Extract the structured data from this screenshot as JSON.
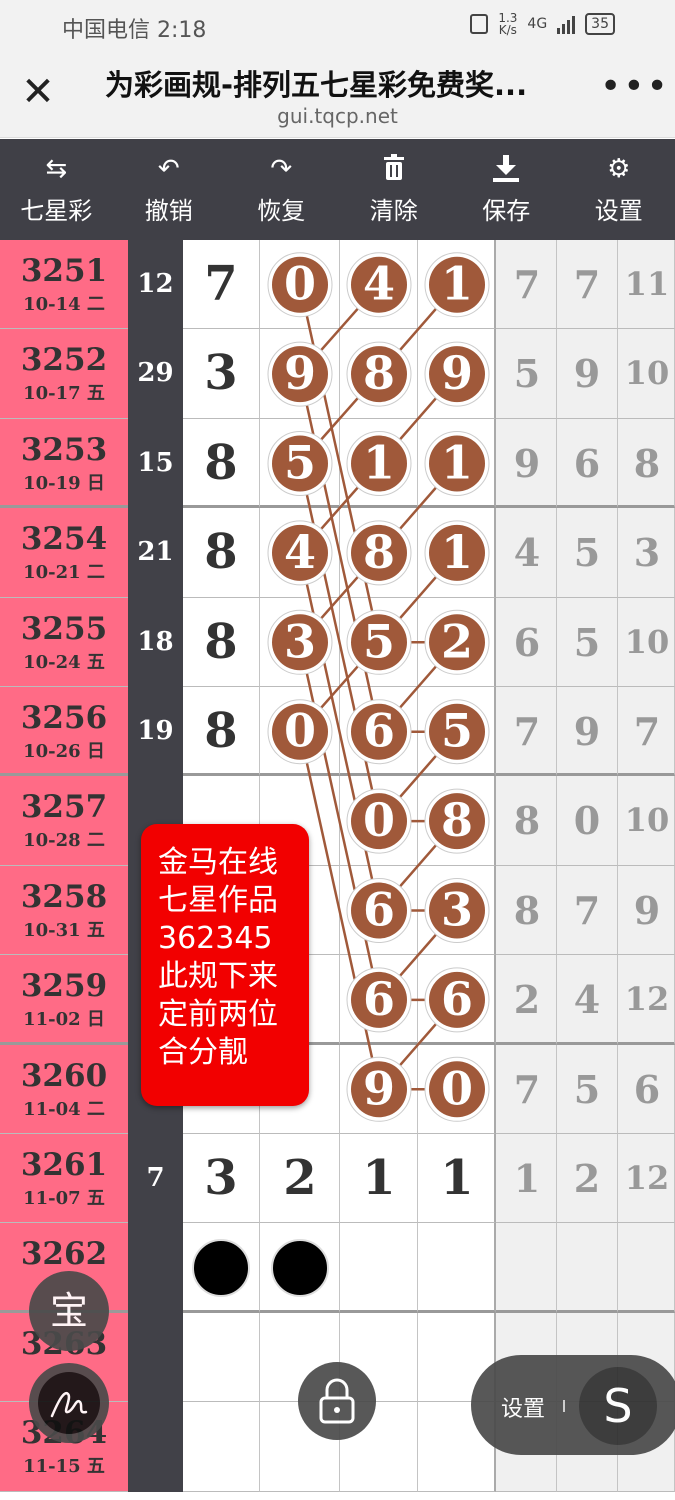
{
  "status_bar": {
    "carrier_time": "中国电信 2:18",
    "net_speed_value": "1.3",
    "net_speed_unit": "K/s",
    "network": "4G",
    "battery": "35"
  },
  "title_bar": {
    "title": "为彩画规-排列五七星彩免费奖...",
    "url": "gui.tqcp.net",
    "close_icon": "close-icon",
    "more_icon": "more-icon"
  },
  "toolbar": [
    {
      "label": "七星彩",
      "icon": "swap-icon"
    },
    {
      "label": "撤销",
      "icon": "undo-icon"
    },
    {
      "label": "恢复",
      "icon": "redo-icon"
    },
    {
      "label": "清除",
      "icon": "trash-icon"
    },
    {
      "label": "保存",
      "icon": "download-icon"
    },
    {
      "label": "设置",
      "icon": "gear-icon"
    }
  ],
  "rows": [
    {
      "issue": "3251",
      "date": "10-14 二",
      "sum": "12",
      "digits": [
        "7",
        "0",
        "4",
        "1"
      ],
      "circled": [
        false,
        true,
        true,
        true
      ],
      "tail": [
        "7",
        "7",
        "11"
      ]
    },
    {
      "issue": "3252",
      "date": "10-17 五",
      "sum": "29",
      "digits": [
        "3",
        "9",
        "8",
        "9"
      ],
      "circled": [
        false,
        true,
        true,
        true
      ],
      "tail": [
        "5",
        "9",
        "10"
      ]
    },
    {
      "issue": "3253",
      "date": "10-19 日",
      "sum": "15",
      "digits": [
        "8",
        "5",
        "1",
        "1"
      ],
      "circled": [
        false,
        true,
        true,
        true
      ],
      "tail": [
        "9",
        "6",
        "8"
      ]
    },
    {
      "issue": "3254",
      "date": "10-21 二",
      "sum": "21",
      "digits": [
        "8",
        "4",
        "8",
        "1"
      ],
      "circled": [
        false,
        true,
        true,
        true
      ],
      "tail": [
        "4",
        "5",
        "3"
      ]
    },
    {
      "issue": "3255",
      "date": "10-24 五",
      "sum": "18",
      "digits": [
        "8",
        "3",
        "5",
        "2"
      ],
      "circled": [
        false,
        true,
        true,
        true
      ],
      "tail": [
        "6",
        "5",
        "10"
      ]
    },
    {
      "issue": "3256",
      "date": "10-26 日",
      "sum": "19",
      "digits": [
        "8",
        "0",
        "6",
        "5"
      ],
      "circled": [
        false,
        true,
        true,
        true
      ],
      "tail": [
        "7",
        "9",
        "7"
      ]
    },
    {
      "issue": "3257",
      "date": "10-28 二",
      "sum": "",
      "digits": [
        "",
        "",
        "0",
        "8"
      ],
      "circled": [
        false,
        false,
        true,
        true
      ],
      "tail": [
        "8",
        "0",
        "10"
      ]
    },
    {
      "issue": "3258",
      "date": "10-31 五",
      "sum": "",
      "digits": [
        "",
        "",
        "6",
        "3"
      ],
      "circled": [
        false,
        false,
        true,
        true
      ],
      "tail": [
        "8",
        "7",
        "9"
      ]
    },
    {
      "issue": "3259",
      "date": "11-02 日",
      "sum": "",
      "digits": [
        "",
        "",
        "6",
        "6"
      ],
      "circled": [
        false,
        false,
        true,
        true
      ],
      "tail": [
        "2",
        "4",
        "12"
      ]
    },
    {
      "issue": "3260",
      "date": "11-04 二",
      "sum": "",
      "digits": [
        "",
        "",
        "9",
        "0"
      ],
      "circled": [
        false,
        false,
        true,
        true
      ],
      "tail": [
        "7",
        "5",
        "6"
      ]
    },
    {
      "issue": "3261",
      "date": "11-07 五",
      "sum": "7",
      "digits": [
        "3",
        "2",
        "1",
        "1"
      ],
      "circled": [
        false,
        false,
        false,
        false
      ],
      "tail": [
        "1",
        "2",
        "12"
      ]
    },
    {
      "issue": "3262",
      "date": "",
      "sum": "",
      "digits": [
        "",
        "",
        "",
        ""
      ],
      "circled": [
        false,
        false,
        false,
        false
      ],
      "tail": [
        "",
        "",
        ""
      ],
      "dots": [
        true,
        true,
        false,
        false
      ]
    },
    {
      "issue": "3263",
      "date": "",
      "sum": "",
      "digits": [
        "",
        "",
        "",
        ""
      ],
      "circled": [
        false,
        false,
        false,
        false
      ],
      "tail": [
        "",
        "",
        ""
      ]
    },
    {
      "issue": "3264",
      "date": "11-15 五",
      "sum": "",
      "digits": [
        "",
        "",
        "",
        ""
      ],
      "circled": [
        false,
        false,
        false,
        false
      ],
      "tail": [
        "",
        "",
        ""
      ]
    }
  ],
  "note": {
    "lines": [
      "金马在线",
      "七星作品",
      "362345",
      "此规下来",
      "定前两位",
      "合分靓"
    ]
  },
  "fabs": {
    "treasure_label": "宝",
    "settings_label": "设置",
    "s_label": "S"
  },
  "colors": {
    "issue_bg": "#ff6b86",
    "sum_bg": "#414148",
    "circle_fill": "#a0593a",
    "line": "#a0593a",
    "note_bg": "#f20000",
    "toolbar_bg": "#404047"
  }
}
